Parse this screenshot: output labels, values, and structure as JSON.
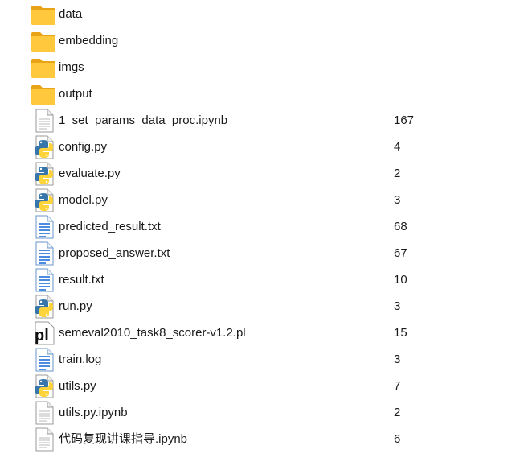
{
  "files": [
    {
      "name": "data",
      "size": "",
      "icon": "folder-icon"
    },
    {
      "name": "embedding",
      "size": "",
      "icon": "folder-icon"
    },
    {
      "name": "imgs",
      "size": "",
      "icon": "folder-icon"
    },
    {
      "name": "output",
      "size": "",
      "icon": "folder-icon"
    },
    {
      "name": "1_set_params_data_proc.ipynb",
      "size": "167",
      "icon": "generic-file-icon"
    },
    {
      "name": "config.py",
      "size": "4",
      "icon": "python-file-icon"
    },
    {
      "name": "evaluate.py",
      "size": "2",
      "icon": "python-file-icon"
    },
    {
      "name": "model.py",
      "size": "3",
      "icon": "python-file-icon"
    },
    {
      "name": "predicted_result.txt",
      "size": "68",
      "icon": "text-file-icon"
    },
    {
      "name": "proposed_answer.txt",
      "size": "67",
      "icon": "text-file-icon"
    },
    {
      "name": "result.txt",
      "size": "10",
      "icon": "text-file-icon"
    },
    {
      "name": "run.py",
      "size": "3",
      "icon": "python-file-icon"
    },
    {
      "name": "semeval2010_task8_scorer-v1.2.pl",
      "size": "15",
      "icon": "perl-file-icon"
    },
    {
      "name": "train.log",
      "size": "3",
      "icon": "text-file-icon"
    },
    {
      "name": "utils.py",
      "size": "7",
      "icon": "python-file-icon"
    },
    {
      "name": "utils.py.ipynb",
      "size": "2",
      "icon": "generic-file-icon"
    },
    {
      "name": "代码复现讲课指导.ipynb",
      "size": "6",
      "icon": "generic-file-icon"
    }
  ],
  "colors": {
    "folder": "#FFC83D",
    "folder_dark": "#E8A317",
    "python_blue": "#3776AB",
    "python_yellow": "#FFD43B",
    "text_file_blue": "#1E6FD9",
    "generic_file_border": "#9A9A9A"
  }
}
